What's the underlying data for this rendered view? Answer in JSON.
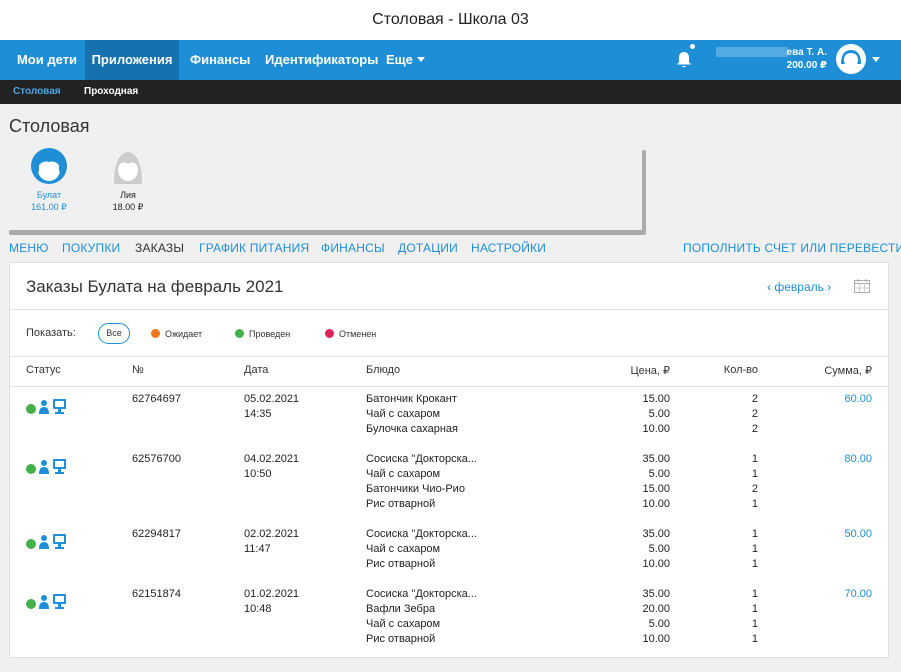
{
  "window": {
    "title": "Столовая - Школа 03"
  },
  "topnav": {
    "items": [
      {
        "label": "Мои дети"
      },
      {
        "label": "Приложения"
      },
      {
        "label": "Финансы"
      },
      {
        "label": "Идентификаторы"
      },
      {
        "label": "Еще"
      }
    ],
    "user": {
      "name": "ева Т. А.",
      "balance": "200.00 ₽"
    }
  },
  "subnav": {
    "items": [
      {
        "label": "Столовая"
      },
      {
        "label": "Проходная"
      }
    ]
  },
  "page": {
    "title": "Столовая"
  },
  "children": [
    {
      "name": "Булат",
      "balance": "161.00 ₽"
    },
    {
      "name": "Лия",
      "balance": "18.00 ₽"
    }
  ],
  "tabs": [
    {
      "label": "МЕНЮ"
    },
    {
      "label": "ПОКУПКИ"
    },
    {
      "label": "ЗАКАЗЫ"
    },
    {
      "label": "ГРАФИК ПИТАНИЯ"
    },
    {
      "label": "ФИНАНСЫ"
    },
    {
      "label": "ДОТАЦИИ"
    },
    {
      "label": "НАСТРОЙКИ"
    }
  ],
  "topup_label": "ПОПОЛНИТЬ СЧЕТ ИЛИ ПЕРЕВЕСТИ",
  "orders": {
    "title": "Заказы Булата на февраль 2021",
    "month": "февраль",
    "filter": {
      "label": "Показать:",
      "options": [
        {
          "label": "Все"
        },
        {
          "label": "Ожидает",
          "color": "#f07a1a"
        },
        {
          "label": "Проведен",
          "color": "#43b049"
        },
        {
          "label": "Отменен",
          "color": "#e0245e"
        }
      ]
    },
    "columns": {
      "status": "Статус",
      "number": "№",
      "date": "Дата",
      "dish": "Блюдо",
      "price": "Цена, ₽",
      "qty": "Кол-во",
      "sum": "Сумма, ₽"
    },
    "rows": [
      {
        "number": "62764697",
        "date": "05.02.2021",
        "time": "14:35",
        "dishes": [
          "Батончик Крокант",
          "Чай с сахаром",
          "Булочка сахарная"
        ],
        "prices": [
          "15.00",
          "5.00",
          "10.00"
        ],
        "qty": [
          "2",
          "2",
          "2"
        ],
        "sum": "60.00"
      },
      {
        "number": "62576700",
        "date": "04.02.2021",
        "time": "10:50",
        "dishes": [
          "Сосиска \"Докторска...",
          "Чай с сахаром",
          "Батончики Чио-Рио",
          "Рис отварной"
        ],
        "prices": [
          "35.00",
          "5.00",
          "15.00",
          "10.00"
        ],
        "qty": [
          "1",
          "1",
          "2",
          "1"
        ],
        "sum": "80.00"
      },
      {
        "number": "62294817",
        "date": "02.02.2021",
        "time": "11:47",
        "dishes": [
          "Сосиска \"Докторска...",
          "Чай с сахаром",
          "Рис отварной"
        ],
        "prices": [
          "35.00",
          "5.00",
          "10.00"
        ],
        "qty": [
          "1",
          "1",
          "1"
        ],
        "sum": "50.00"
      },
      {
        "number": "62151874",
        "date": "01.02.2021",
        "time": "10:48",
        "dishes": [
          "Сосиска \"Докторска...",
          "Вафли Зебра",
          "Чай с сахаром",
          "Рис отварной"
        ],
        "prices": [
          "35.00",
          "20.00",
          "5.00",
          "10.00"
        ],
        "qty": [
          "1",
          "1",
          "1",
          "1"
        ],
        "sum": "70.00"
      }
    ]
  },
  "colors": {
    "accent": "#1e8fd6",
    "accent_dark": "#1672ae",
    "subnav_bg": "#222222"
  }
}
